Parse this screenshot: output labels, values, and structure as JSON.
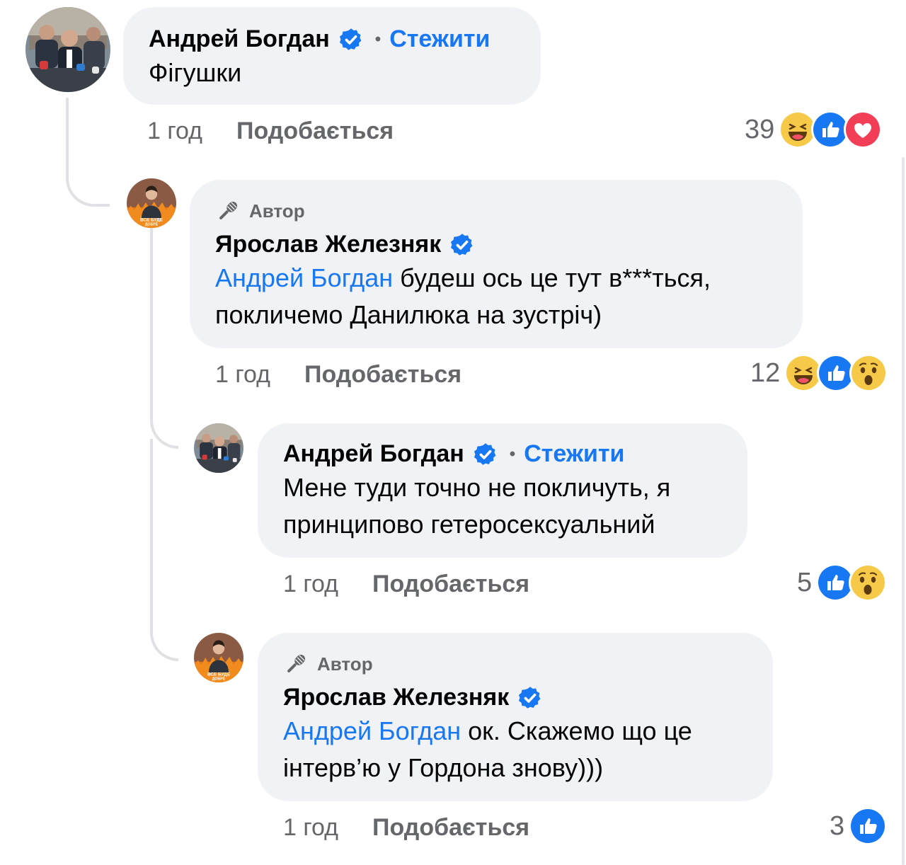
{
  "comments": [
    {
      "author": "Андрей Богдан",
      "follow": "Стежити",
      "text": "Фігушки",
      "time": "1 год",
      "like": "Подобається",
      "reaction_count": "39",
      "reactions": [
        "haha-icon",
        "like-icon",
        "love-icon"
      ]
    },
    {
      "badge": "Автор",
      "author": "Ярослав Железняк",
      "mention": "Андрей Богдан",
      "text_line1": " будеш ось це тут в***ться,",
      "text_line2": "покличемо Данилюка на зустріч)",
      "time": "1 год",
      "like": "Подобається",
      "reaction_count": "12",
      "reactions": [
        "haha-icon",
        "like-icon",
        "wow-icon"
      ]
    },
    {
      "author": "Андрей Богдан",
      "follow": "Стежити",
      "text_line1": "Мене туди точно не покличуть, я",
      "text_line2": "принципово гетеросексуальний",
      "time": "1 год",
      "like": "Подобається",
      "reaction_count": "5",
      "reactions": [
        "like-icon",
        "wow-icon"
      ]
    },
    {
      "badge": "Автор",
      "author": "Ярослав Железняк",
      "mention": "Андрей Богдан",
      "text_line1": " ок. Скажемо що це",
      "text_line2": "інтерв’ю у Гордона знову)))",
      "time": "1 год",
      "like": "Подобається",
      "reaction_count": "3",
      "reactions": [
        "like-icon"
      ]
    }
  ],
  "avatar_caption": "ВСЕ БУДЕ ДОБРЕ",
  "colors": {
    "accent": "#1877f2",
    "bubble": "#f0f2f5",
    "muted": "#65676b"
  }
}
